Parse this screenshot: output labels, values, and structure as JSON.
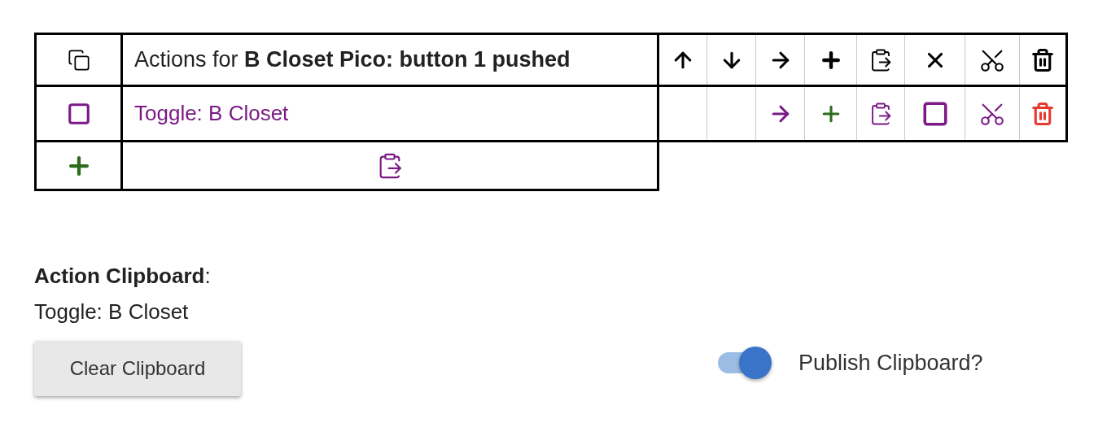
{
  "actions_table": {
    "header": "Actions for **B Closet Pico: button 1 pushed**",
    "actions": [
      {
        "label": "Toggle: B Closet",
        "checked": false
      }
    ]
  },
  "clipboard": {
    "title": "**Action Clipboard**:",
    "content": "Toggle: B Closet",
    "clear_button": "Clear Clipboard",
    "publish": {
      "label": "Publish Clipboard?",
      "on": true
    }
  }
}
